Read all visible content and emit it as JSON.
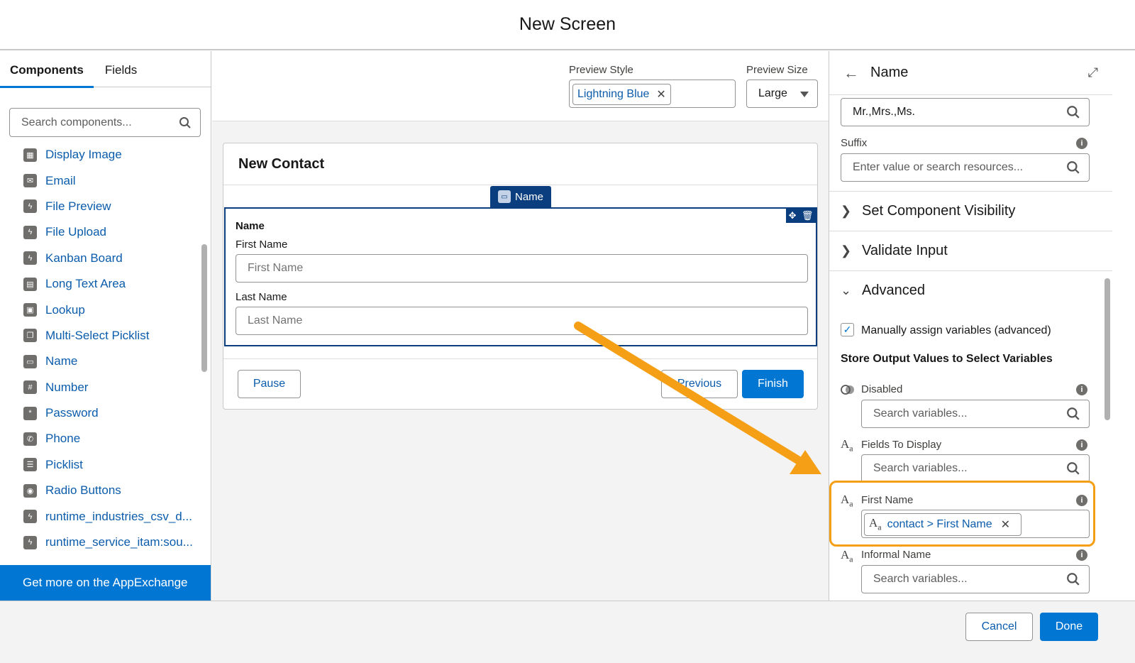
{
  "header": {
    "title": "New Screen"
  },
  "left": {
    "tabs": [
      "Components",
      "Fields"
    ],
    "search_placeholder": "Search components...",
    "components": [
      {
        "label": "Display Image",
        "icon": "image-icon"
      },
      {
        "label": "Email",
        "icon": "email-icon"
      },
      {
        "label": "File Preview",
        "icon": "lightning-icon"
      },
      {
        "label": "File Upload",
        "icon": "lightning-icon"
      },
      {
        "label": "Kanban Board",
        "icon": "lightning-icon"
      },
      {
        "label": "Long Text Area",
        "icon": "textarea-icon"
      },
      {
        "label": "Lookup",
        "icon": "lookup-icon"
      },
      {
        "label": "Multi-Select Picklist",
        "icon": "multipicklist-icon"
      },
      {
        "label": "Name",
        "icon": "name-card-icon"
      },
      {
        "label": "Number",
        "icon": "number-icon"
      },
      {
        "label": "Password",
        "icon": "password-icon"
      },
      {
        "label": "Phone",
        "icon": "phone-icon"
      },
      {
        "label": "Picklist",
        "icon": "picklist-icon"
      },
      {
        "label": "Radio Buttons",
        "icon": "radio-icon"
      },
      {
        "label": "runtime_industries_csv_d...",
        "icon": "lightning-icon"
      },
      {
        "label": "runtime_service_itam:sou...",
        "icon": "lightning-icon"
      }
    ],
    "appexchange": "Get more on the AppExchange"
  },
  "preview": {
    "style_label": "Preview Style",
    "style_value": "Lightning Blue",
    "size_label": "Preview Size",
    "size_value": "Large"
  },
  "canvas": {
    "card_title": "New Contact",
    "component_tag": "Name",
    "field_group": "Name",
    "first_name_label": "First Name",
    "first_name_placeholder": "First Name",
    "last_name_label": "Last Name",
    "last_name_placeholder": "Last Name",
    "pause": "Pause",
    "previous": "Previous",
    "finish": "Finish"
  },
  "right": {
    "title": "Name",
    "salutation_value": "Mr.,Mrs.,Ms.",
    "suffix_label": "Suffix",
    "suffix_placeholder": "Enter value or search resources...",
    "sections": [
      "Set Component Visibility",
      "Validate Input",
      "Advanced"
    ],
    "manual_assign": "Manually assign variables (advanced)",
    "store_heading": "Store Output Values to Select Variables",
    "disabled_label": "Disabled",
    "fields_display_label": "Fields To Display",
    "first_name_label": "First Name",
    "first_name_value": "contact > First Name",
    "informal_label": "Informal Name",
    "var_placeholder": "Search variables...",
    "aa_main": "A",
    "aa_sub": "a"
  },
  "footer": {
    "cancel": "Cancel",
    "done": "Done"
  },
  "colors": {
    "brand": "#0176d3",
    "highlight": "#f59f16",
    "selection": "#0b3e7e"
  }
}
